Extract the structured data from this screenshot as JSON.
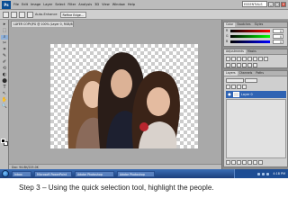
{
  "app": {
    "logo_text": "Ps",
    "menus": [
      "File",
      "Edit",
      "Image",
      "Layer",
      "Select",
      "Filter",
      "Analysis",
      "3D",
      "View",
      "Window",
      "Help"
    ],
    "workspace": "ESSENTIALS",
    "window_controls": [
      "_",
      "□",
      "×"
    ]
  },
  "options": {
    "labels": [
      "Auto-Enhance"
    ],
    "buttons": [
      "Refine Edge..."
    ]
  },
  "document": {
    "tab_title": "LAYER COPY.JPG @ 100% (Layer 0, RGB/8)"
  },
  "tools": [
    "▸",
    "⬚",
    "⌕",
    "✂",
    "⌗",
    "✎",
    "✐",
    "⟲",
    "◐",
    "⬤",
    "T",
    "↖",
    "✋",
    "🔍"
  ],
  "status": {
    "text": "Doc: 94.8K/225.0K"
  },
  "panels": {
    "color_tabs": [
      "Color",
      "Swatches",
      "Styles"
    ],
    "sliders": [
      {
        "label": "R",
        "value": "0"
      },
      {
        "label": "G",
        "value": "0"
      },
      {
        "label": "B",
        "value": "0"
      }
    ],
    "adjust_tabs": [
      "Adjustments",
      "Masks"
    ],
    "layers_tabs": [
      "Layers",
      "Channels",
      "Paths"
    ],
    "layer_name": "Layer 0"
  },
  "taskbar": {
    "buttons": [
      "Inbox",
      "Microsoft PowerPoint",
      "Adobe Photoshop",
      "Adobe Photoshop"
    ],
    "clock": "4:18 PM"
  },
  "caption": "Step 3 – Using the quick selection tool, highlight the people.",
  "colors": {
    "accent": "#2f63b3",
    "canvas_bg": "#a9a9a9",
    "taskbar": "#1b3f7c"
  }
}
